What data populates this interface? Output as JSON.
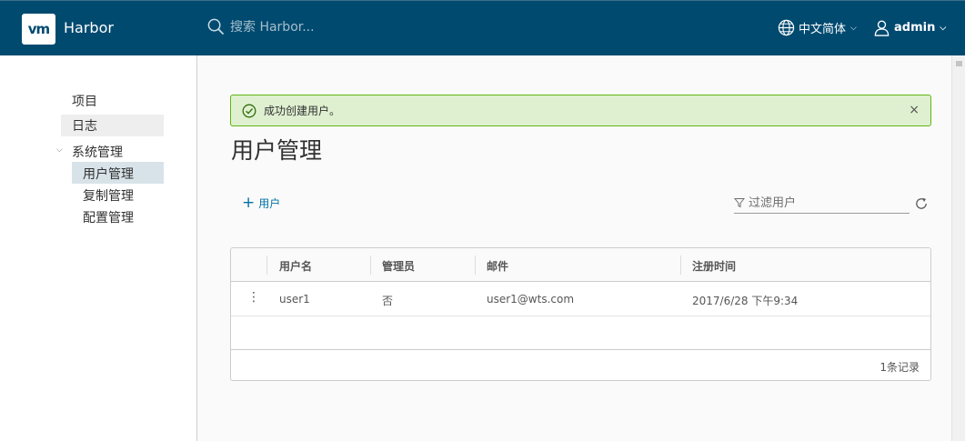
{
  "header": {
    "logo_text": "vm",
    "brand": "Harbor",
    "search_placeholder": "搜索 Harbor...",
    "language": "中文简体",
    "user": "admin",
    "bg_color": "#004a70"
  },
  "sidebar": {
    "items": [
      {
        "label": "项目"
      },
      {
        "label": "日志"
      },
      {
        "label": "系统管理"
      },
      {
        "label": "用户管理"
      },
      {
        "label": "复制管理"
      },
      {
        "label": "配置管理"
      }
    ]
  },
  "alert": {
    "message": "成功创建用户。",
    "close": "×",
    "color": "#60b515"
  },
  "main": {
    "title": "用户管理",
    "add_user_label": "用户",
    "filter_placeholder": "过滤用户"
  },
  "table": {
    "columns": [
      "用户名",
      "管理员",
      "邮件",
      "注册时间"
    ],
    "rows": [
      {
        "name": "user1",
        "admin": "否",
        "email": "user1@wts.com",
        "time": "2017/6/28 下午9:34"
      }
    ],
    "footer": "1条记录"
  }
}
